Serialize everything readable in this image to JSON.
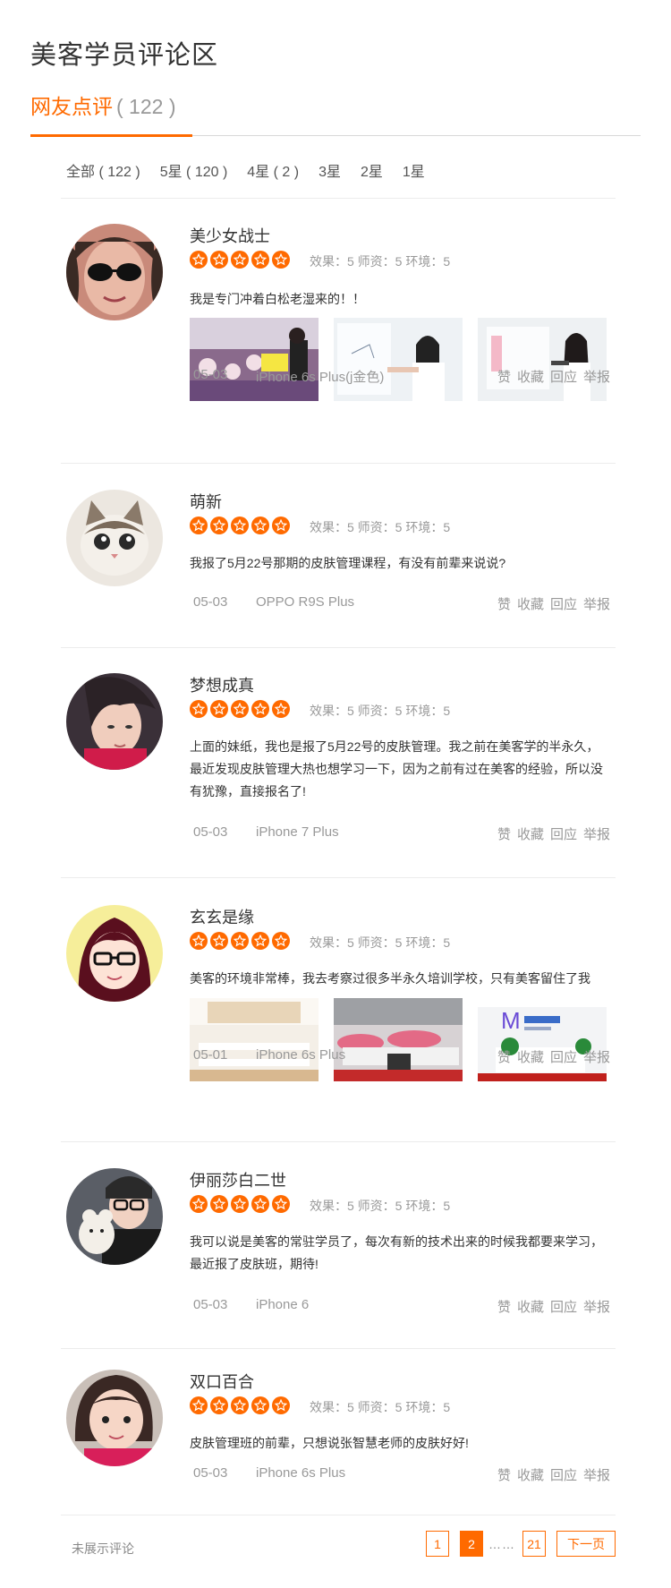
{
  "page": {
    "title": "美客学员评论区"
  },
  "section": {
    "tab_label": "网友点评",
    "tab_count": "( 122 )"
  },
  "filters": [
    {
      "label": "全部 ( 122 )"
    },
    {
      "label": "5星 ( 120 )"
    },
    {
      "label": "4星 ( 2 )"
    },
    {
      "label": "3星"
    },
    {
      "label": "2星"
    },
    {
      "label": "1星"
    }
  ],
  "common": {
    "scores": "效果：5 师资：5 环境：5",
    "actions": {
      "like": "赞",
      "collect": "收藏",
      "reply": "回应",
      "report": "举报"
    }
  },
  "reviews": [
    {
      "name": "美少女战士",
      "text": "我是专门冲着白松老湿来的！！",
      "date": "05-03",
      "device": "iPhone 6s Plus(j金色)",
      "photos": 3
    },
    {
      "name": "萌新",
      "text": "我报了5月22号那期的皮肤管理课程，有没有前辈来说说?",
      "date": "05-03",
      "device": "OPPO R9S Plus",
      "photos": 0
    },
    {
      "name": "梦想成真",
      "text": "上面的妹纸，我也是报了5月22号的皮肤管理。我之前在美客学的半永久，最近发现皮肤管理大热也想学习一下，因为之前有过在美客的经验，所以没有犹豫，直接报名了!",
      "date": "05-03",
      "device": "iPhone 7 Plus",
      "photos": 0
    },
    {
      "name": "玄玄是缘",
      "text": "美客的环境非常棒，我去考察过很多半永久培训学校，只有美客留住了我",
      "date": "05-01",
      "device": "iPhone 6s Plus",
      "photos": 3
    },
    {
      "name": "伊丽莎白二世",
      "text": "我可以说是美客的常驻学员了，每次有新的技术出来的时候我都要来学习，最近报了皮肤班，期待!",
      "date": "05-03",
      "device": "iPhone 6",
      "photos": 0
    },
    {
      "name": "双口百合",
      "text": "皮肤管理班的前辈，只想说张智慧老师的皮肤好好!",
      "date": "05-03",
      "device": "iPhone 6s Plus",
      "photos": 0
    }
  ],
  "footer": {
    "hidden_comments": "未展示评论",
    "pages": {
      "p1": "1",
      "p2": "2",
      "dots": "……",
      "last": "21",
      "next": "下一页"
    }
  },
  "colors": {
    "accent": "#ff6a00",
    "text": "#333333",
    "muted": "#999999"
  }
}
